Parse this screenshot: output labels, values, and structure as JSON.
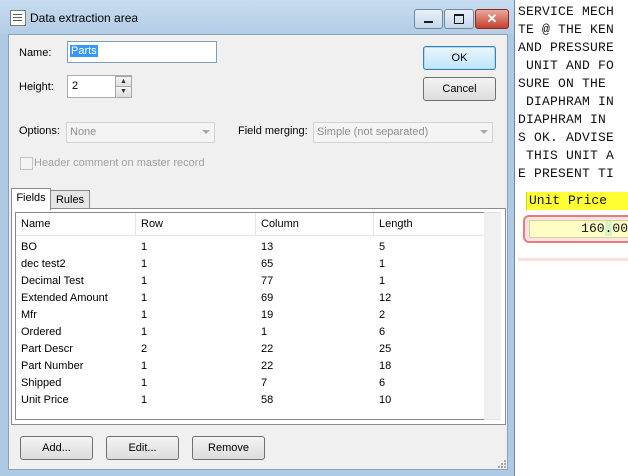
{
  "window": {
    "title": "Data extraction area",
    "close_glyph": "✕"
  },
  "form": {
    "name_label": "Name:",
    "name_value": "Parts",
    "height_label": "Height:",
    "height_value": "2",
    "options_label": "Options:",
    "options_value": "None",
    "field_merging_label": "Field merging:",
    "field_merging_value": "Simple (not separated)",
    "header_comment_label": "Header comment on master record"
  },
  "buttons": {
    "ok": "OK",
    "cancel": "Cancel",
    "add": "Add...",
    "edit": "Edit...",
    "remove": "Remove"
  },
  "tabs": [
    {
      "label": "Fields",
      "active": true
    },
    {
      "label": "Rules",
      "active": false
    }
  ],
  "table": {
    "columns": [
      "Name",
      "Row",
      "Column",
      "Length"
    ],
    "rows": [
      [
        "BO",
        "1",
        "13",
        "5"
      ],
      [
        "dec test2",
        "1",
        "65",
        "1"
      ],
      [
        "Decimal Test",
        "1",
        "77",
        "1"
      ],
      [
        "Extended Amount",
        "1",
        "69",
        "12"
      ],
      [
        "Mfr",
        "1",
        "19",
        "2"
      ],
      [
        "Ordered",
        "1",
        "1",
        "6"
      ],
      [
        "Part Descr",
        "2",
        "22",
        "25"
      ],
      [
        "Part Number",
        "1",
        "22",
        "18"
      ],
      [
        "Shipped",
        "1",
        "7",
        "6"
      ],
      [
        "Unit Price",
        "1",
        "58",
        "10"
      ]
    ]
  },
  "background_document": {
    "lines": [
      "SERVICE MECH",
      "TE @ THE KEN",
      "AND PRESSURE",
      " UNIT AND FO",
      "SURE ON THE",
      " DIAPHRAM IN",
      "DIAPHRAM IN",
      "S OK. ADVISE",
      " THIS UNIT A",
      "E PRESENT TI"
    ],
    "unit_price_label": "Unit Price",
    "unit_price_int": "160",
    "unit_price_dec": ".",
    "unit_price_frac": "00",
    "highlight_color": "#ffff33",
    "field_border_color": "#e87c7c"
  }
}
